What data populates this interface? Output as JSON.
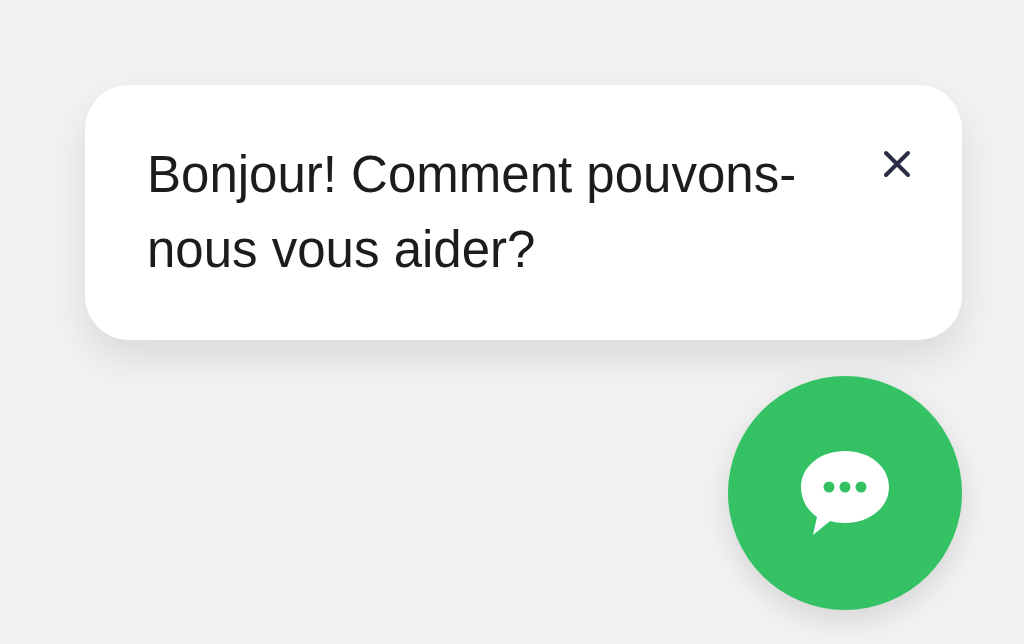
{
  "chat_popup": {
    "message": "Bonjour! Comment pouvons-nous vous aider?"
  }
}
